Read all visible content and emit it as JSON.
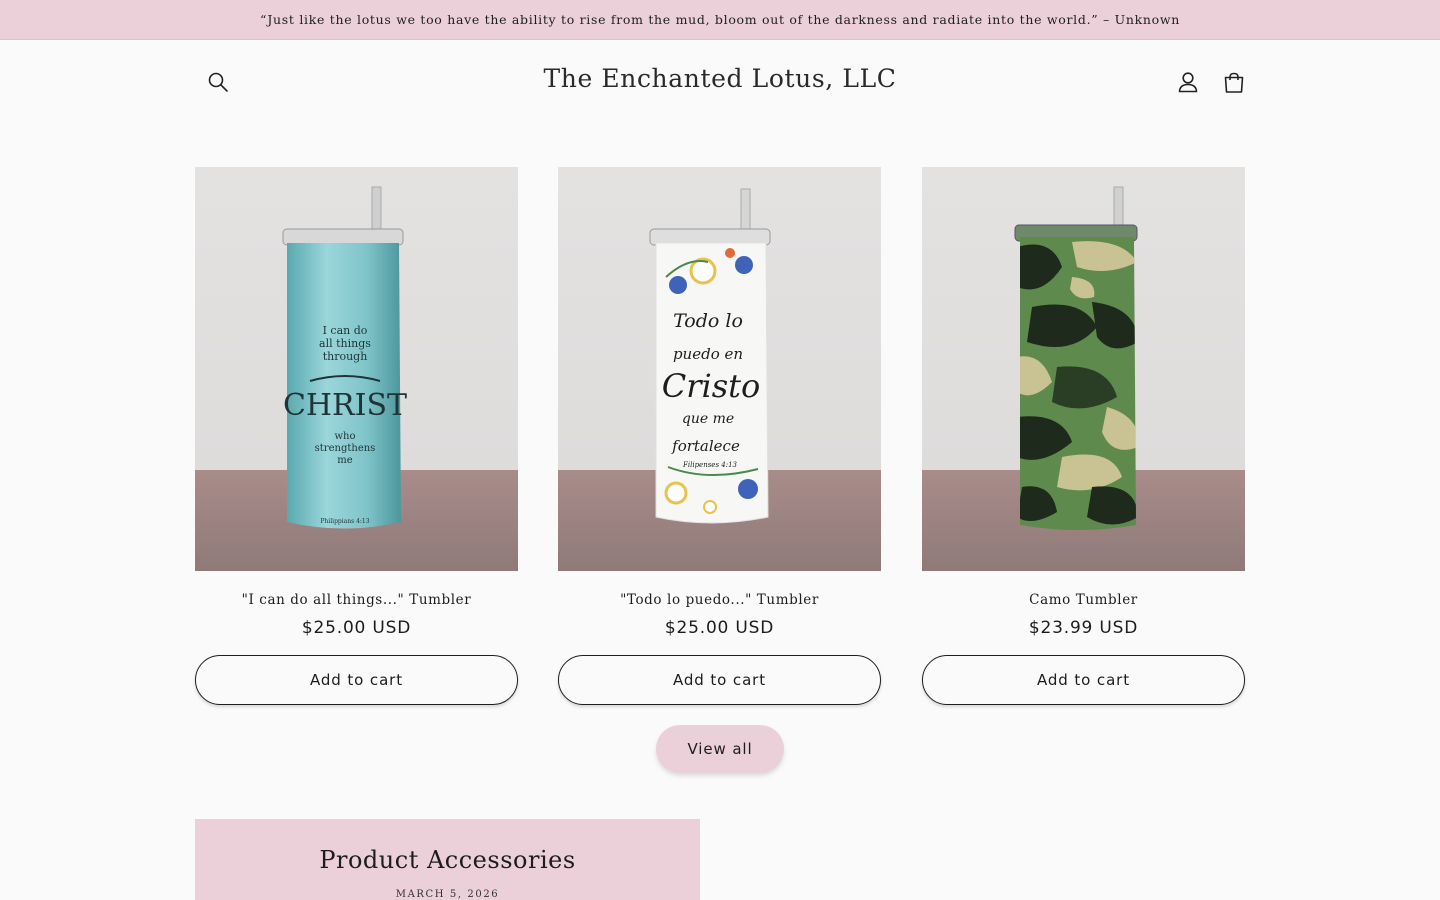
{
  "announcement": {
    "text": "“Just like the lotus we too have the ability to rise from the mud, bloom out of the darkness and radiate into the world.” – Unknown"
  },
  "header": {
    "store_name": "The Enchanted Lotus, LLC",
    "icons": [
      "search-icon",
      "account-icon",
      "cart-icon"
    ]
  },
  "products": [
    {
      "title": "\"I can do all things...\" Tumbler",
      "price": "$25.00 USD",
      "add_to_cart_label": "Add to cart",
      "image_text": [
        "I can do",
        "all things",
        "through",
        "CHRIST",
        "who",
        "strengthens",
        "me",
        "Philippians 4:13"
      ]
    },
    {
      "title": "\"Todo lo puedo...\" Tumbler",
      "price": "$25.00 USD",
      "add_to_cart_label": "Add to cart",
      "image_text": [
        "Todo lo",
        "puedo en",
        "Cristo",
        "que me",
        "fortalece",
        "Filipenses 4:13"
      ]
    },
    {
      "title": "Camo Tumbler",
      "price": "$23.99 USD",
      "add_to_cart_label": "Add to cart"
    }
  ],
  "view_all_label": "View all",
  "blog": {
    "title": "Product Accessories",
    "date": "MARCH 5, 2026"
  },
  "colors": {
    "accent_pink": "#ebd0d9",
    "background": "#fbfafa",
    "text": "#1d1d1d",
    "tumbler_teal": "#7ec3c8",
    "camo_green": "#5f8a4d"
  }
}
